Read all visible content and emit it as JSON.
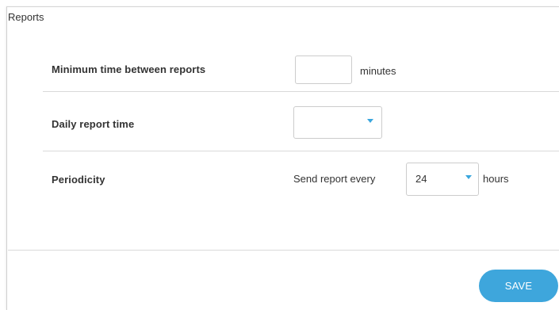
{
  "panel": {
    "title": "Reports"
  },
  "settings": {
    "min_time": {
      "label": "Minimum time between reports",
      "value": "",
      "unit": "minutes"
    },
    "daily_time": {
      "label": "Daily report time",
      "value": ""
    },
    "periodicity": {
      "label": "Periodicity",
      "prefix": "Send report every",
      "value": "24",
      "unit": "hours"
    }
  },
  "footer": {
    "save_label": "SAVE"
  },
  "colors": {
    "accent": "#3ea6dc",
    "border": "#cccccc",
    "divider": "#d9d9d9"
  },
  "icons": {
    "dropdown": "caret-down-icon"
  }
}
